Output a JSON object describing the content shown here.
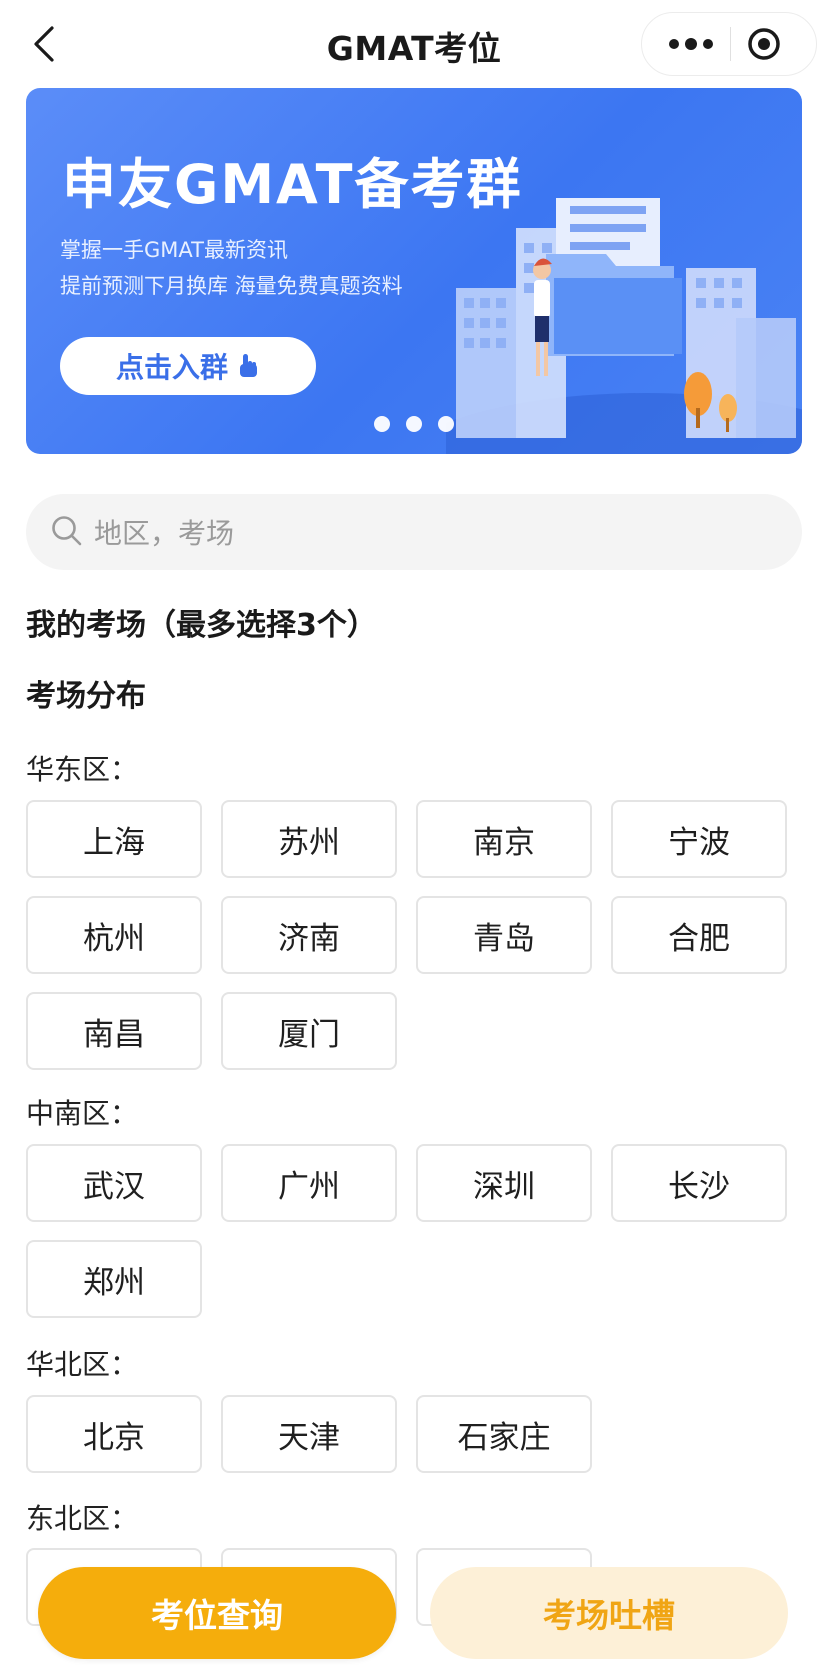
{
  "header": {
    "title": "GMAT考位"
  },
  "banner": {
    "title": "申友GMAT备考群",
    "subtitle_line1": "掌握一手GMAT最新资讯",
    "subtitle_line2": "提前预测下月换库  海量免费真题资料",
    "cta_label": "点击入群",
    "slide_count": 3,
    "active_slide": 1
  },
  "search": {
    "placeholder": "地区，考场",
    "value": ""
  },
  "my_venues": {
    "title": "我的考场（最多选择3个）"
  },
  "distribution": {
    "title": "考场分布",
    "regions": [
      {
        "label": "华东区：",
        "cities": [
          "上海",
          "苏州",
          "南京",
          "宁波",
          "杭州",
          "济南",
          "青岛",
          "合肥",
          "南昌",
          "厦门"
        ]
      },
      {
        "label": "中南区：",
        "cities": [
          "武汉",
          "广州",
          "深圳",
          "长沙",
          "郑州"
        ]
      },
      {
        "label": "华北区：",
        "cities": [
          "北京",
          "天津",
          "石家庄"
        ]
      },
      {
        "label": "东北区：",
        "cities": []
      }
    ]
  },
  "bottom_bar": {
    "query_label": "考位查询",
    "complain_label": "考场吐槽"
  },
  "colors": {
    "accent": "#f5ad0c",
    "accent_light": "#fdf0d7",
    "banner_blue": "#3c76f2"
  }
}
